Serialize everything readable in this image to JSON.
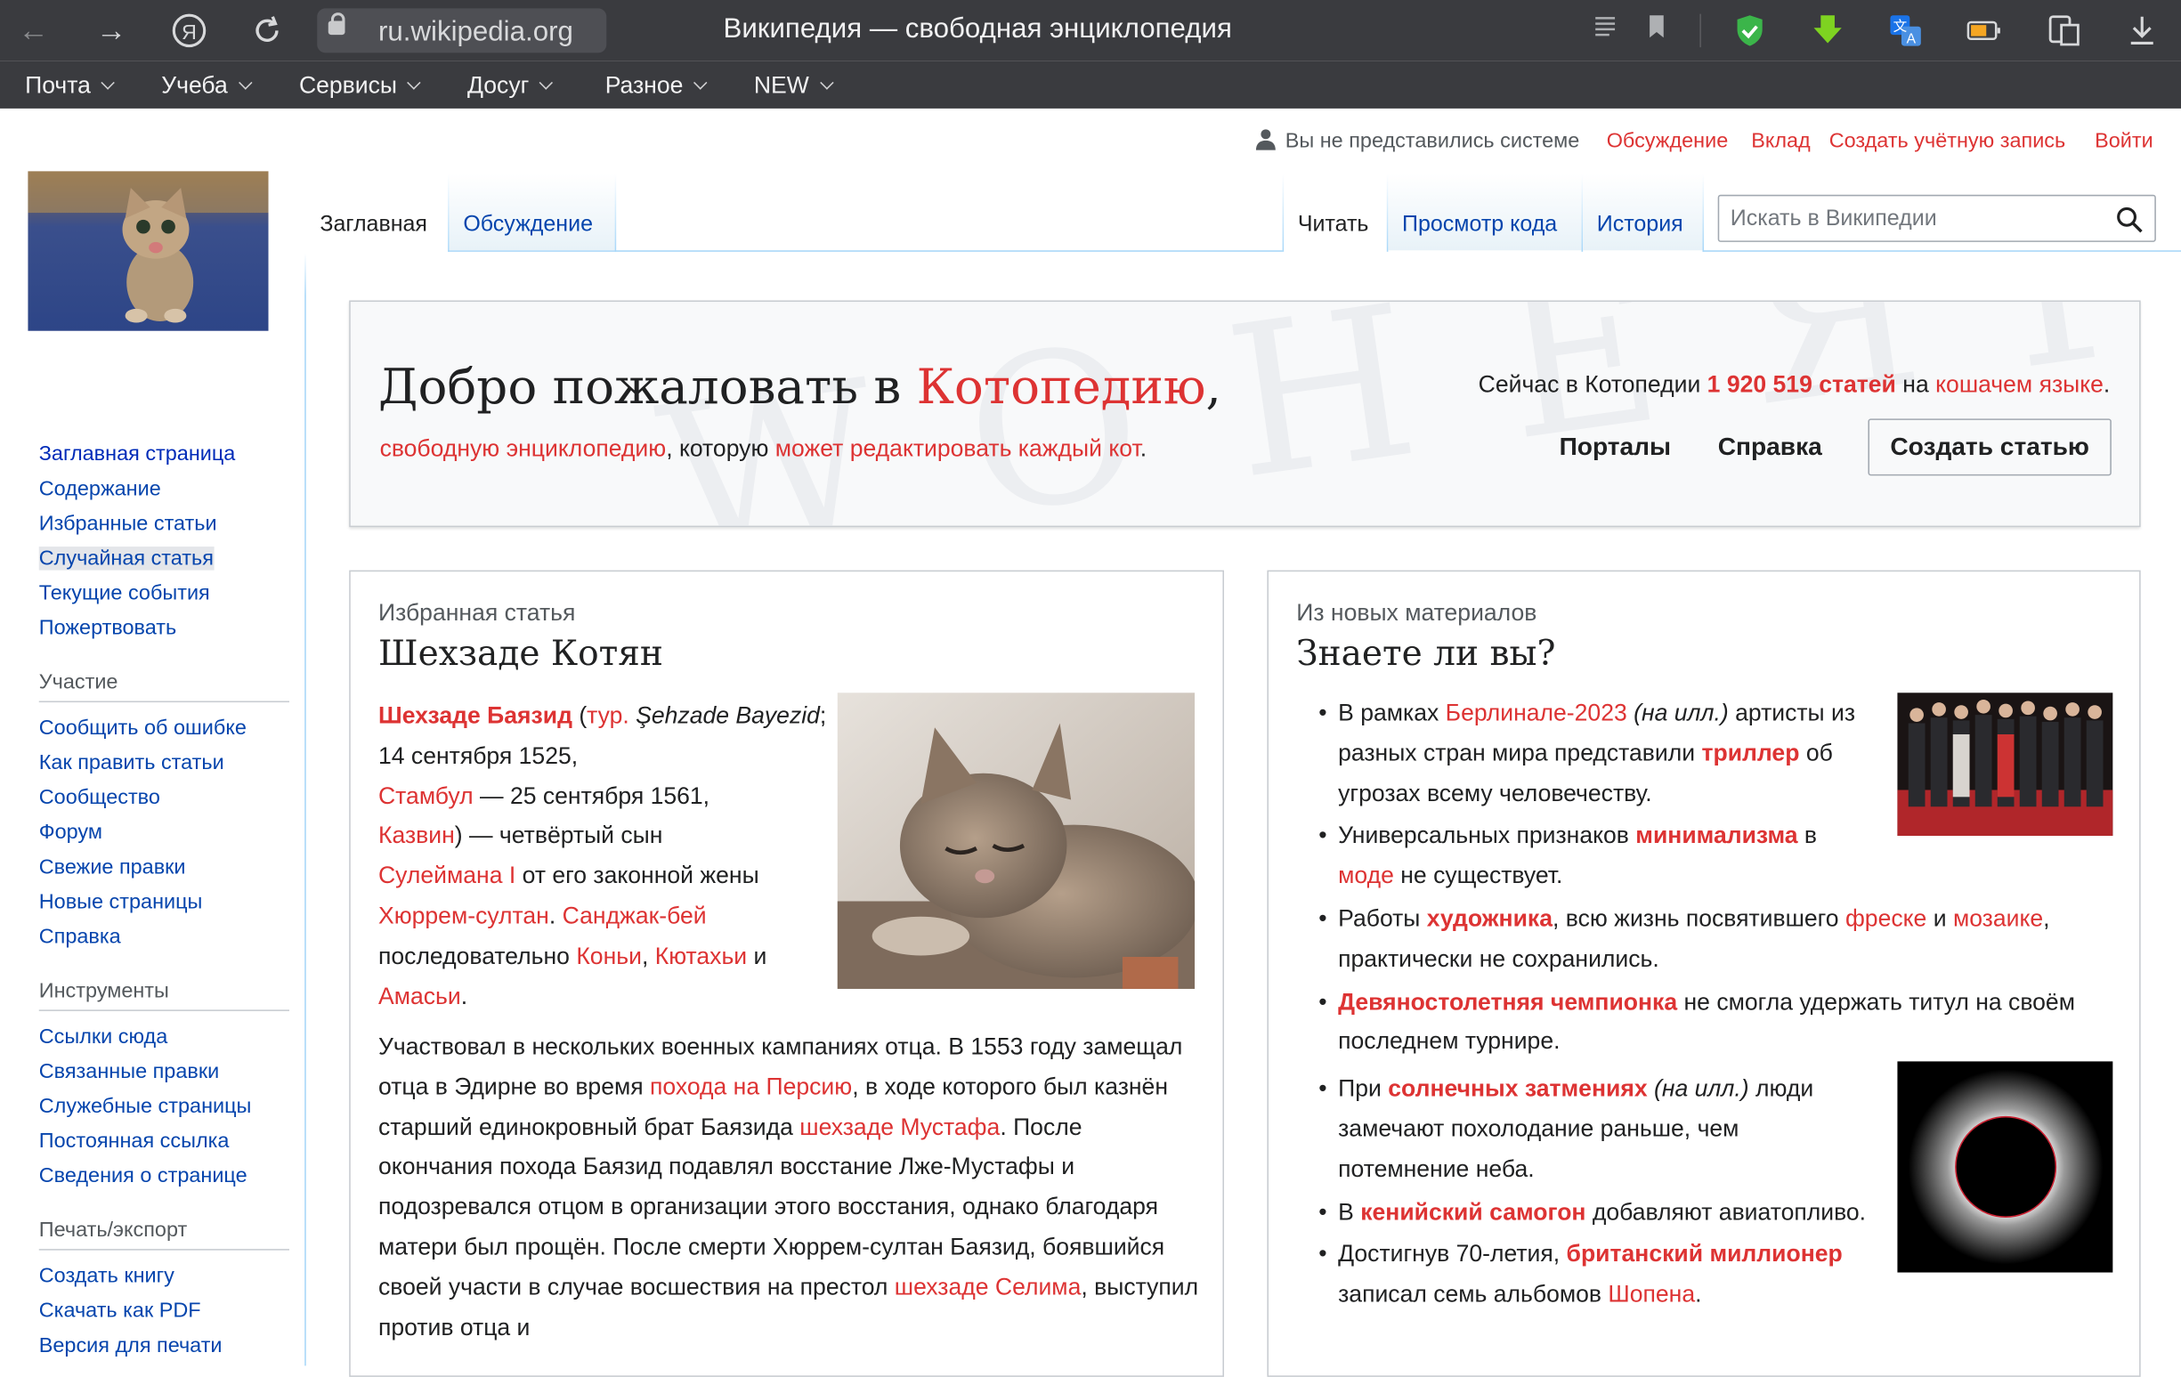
{
  "browser": {
    "url": "ru.wikipedia.org",
    "window_title": "Википедия — свободная энциклопедия",
    "bookmarks": [
      "Почта",
      "Учеба",
      "Сервисы",
      "Досуг",
      "Разное",
      "NEW"
    ]
  },
  "personal": {
    "not_logged": "Вы не представились системе",
    "talk": "Обсуждение",
    "contrib": "Вклад",
    "create_account": "Создать учётную запись",
    "login": "Войти"
  },
  "tabs": {
    "main": "Заглавная",
    "discussion": "Обсуждение",
    "read": "Читать",
    "view_source": "Просмотр кода",
    "history": "История"
  },
  "search": {
    "placeholder": "Искать в Википедии"
  },
  "sidebar": {
    "nav": [
      "Заглавная страница",
      "Содержание",
      "Избранные статьи",
      "Случайная статья",
      "Текущие события",
      "Пожертвовать"
    ],
    "participation_head": "Участие",
    "participation": [
      "Сообщить об ошибке",
      "Как править статьи",
      "Сообщество",
      "Форум",
      "Свежие правки",
      "Новые страницы",
      "Справка"
    ],
    "tools_head": "Инструменты",
    "tools": [
      "Ссылки сюда",
      "Связанные правки",
      "Служебные страницы",
      "Постоянная ссылка",
      "Сведения о странице"
    ],
    "print_head": "Печать/экспорт",
    "print": [
      "Создать книгу",
      "Скачать как PDF",
      "Версия для печати"
    ]
  },
  "welcome": {
    "title_pre": "Добро пожаловать в ",
    "title_link": "Котопедию",
    "title_post": ",",
    "sub_link1": "свободную энциклопедию",
    "sub_mid": ", которую ",
    "sub_link2": "может редактировать каждый кот",
    "sub_end": ".",
    "count_pre": "Сейчас в Котопедии ",
    "count_link": "1 920 519 статей",
    "count_mid": " на ",
    "count_link2": "кошачем языке",
    "count_end": ".",
    "portals": "Порталы",
    "help": "Справка",
    "create": "Создать статью",
    "bg_text": "W О Н Е Я Г"
  },
  "featured": {
    "eyebrow": "Избранная статья",
    "title": "Шехзаде Котян",
    "p1": {
      "name": "Шехзаде Баязид",
      "paren_open": " (",
      "tur": "тур.",
      "tur_name": " Şehzade Bayezid",
      "dates1": "; 14 сентября 1525,",
      "istanbul": "Стамбул",
      "dates2": " — 25 сентября 1561,",
      "kazvin": "Казвин",
      "son": ") — четвёртый сын",
      "suleiman": "Сулеймана I",
      "wife": " от его законной жены",
      "hurrem": "Хюррем-султан",
      "dot": ". ",
      "sanjak": "Санджак-бей",
      "seq": " последовательно ",
      "konya": "Коньи",
      "comma": ", ",
      "kutahya": "Кютахьи",
      "and": " и",
      "amasya": "Амасьи",
      "end": "."
    },
    "p2": {
      "t1": "Участвовал в нескольких военных кампаниях отца. В 1553 году замещал отца в Эдирне во время ",
      "l1": "похода на Персию",
      "t2": ", в ходе которого был казнён старший единокровный брат Баязида ",
      "l2": "шехзаде Мустафа",
      "t3": ". После окончания похода Баязид подавлял восстание Лже-Мустафы и подозревался отцом в организации этого восстания, однако благодаря матери был прощён. После смерти Хюррем-султан Баязид, боявшийся своей участи в случае восшествия на престол ",
      "l3": "шехзаде Селима",
      "t4": ", выступил против отца и"
    }
  },
  "dyk": {
    "eyebrow": "Из новых материалов",
    "title": "Знаете ли вы?",
    "i1": {
      "t1": "В рамках ",
      "l1": "Берлинале-2023",
      "t2": " ",
      "ill": "(на илл.)",
      "t3": " артисты из разных стран мира представили ",
      "l2": "триллер",
      "t4": " об угрозах всему человечеству."
    },
    "i2": {
      "t1": "Универсальных признаков ",
      "l1": "минимализма",
      "t2": " в ",
      "l2": "моде",
      "t3": " не существует."
    },
    "i3": {
      "t1": "Работы ",
      "l1": "художника",
      "t2": ", всю жизнь посвятившего ",
      "l2": "фреске",
      "t3": " и ",
      "l3": "мозаике",
      "t4": ", практически не сохранились."
    },
    "i4": {
      "l1": "Девяностолетняя чемпионка",
      "t1": " не смогла удержать титул на своём последнем турнире."
    },
    "i5": {
      "t1": "При ",
      "l1": "солнечных затмениях",
      "t2": " ",
      "ill": "(на илл.)",
      "t3": " люди замечают похолодание раньше, чем потемнение неба."
    },
    "i6": {
      "t1": "В ",
      "l1": "кенийский самогон",
      "t2": " добавляют авиатопливо."
    },
    "i7": {
      "t1": "Достигнув 70-летия, ",
      "l1": "британский миллионер",
      "t2": " записал семь альбомов ",
      "l2": "Шопена",
      "t3": "."
    }
  },
  "colors": {
    "link_red": "#dd3333",
    "link_blue": "#0645ad",
    "chrome": "#3a3b3f"
  }
}
